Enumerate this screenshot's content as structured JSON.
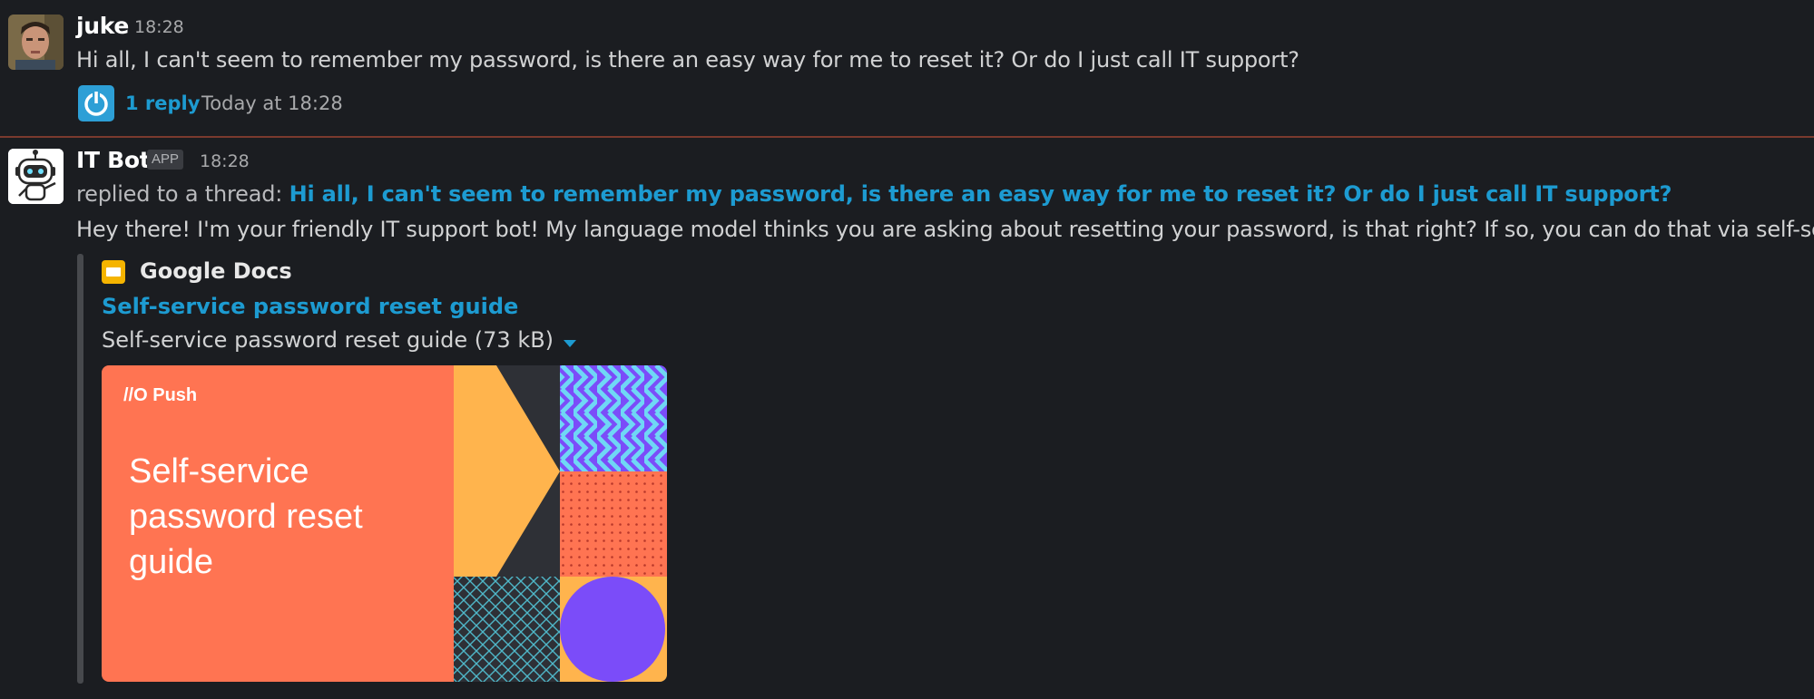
{
  "messages": [
    {
      "author": "juke",
      "time": "18:28",
      "text": "Hi all, I can't seem to remember my password, is there an easy way for me to reset it? Or do I just call IT support?",
      "thread": {
        "reply_count": "1 reply",
        "last_reply": "Today at 18:28"
      }
    },
    {
      "author": "IT Bot",
      "badge": "APP",
      "time": "18:28",
      "reply_prefix": "replied to a thread:",
      "reply_quote": "Hi all, I can't seem to remember my password, is there an easy way for me to reset it? Or do I just call IT support?",
      "text": "Hey there! I'm your friendly IT support bot! My language model thinks you are asking about resetting your password, is that right? If so, you can do that via self-service",
      "trailing_dot": ".",
      "attachment": {
        "service": "Google Docs",
        "title": "Self-service password reset guide",
        "file_label": "Self-service password reset guide (73 kB)",
        "preview": {
          "brand": "//O Push",
          "title_lines": [
            "Self-service",
            "password reset",
            "guide"
          ]
        }
      }
    }
  ],
  "colors": {
    "background": "#1b1d21",
    "link": "#1d9bd1",
    "divider": "#7a3a2e",
    "preview_orange": "#ff7452",
    "preview_yellow": "#ffb44d",
    "preview_purple": "#7b4cf9"
  },
  "icons": [
    "user-avatar",
    "bot-avatar",
    "power-icon",
    "google-docs-icon",
    "caret-down-icon"
  ]
}
